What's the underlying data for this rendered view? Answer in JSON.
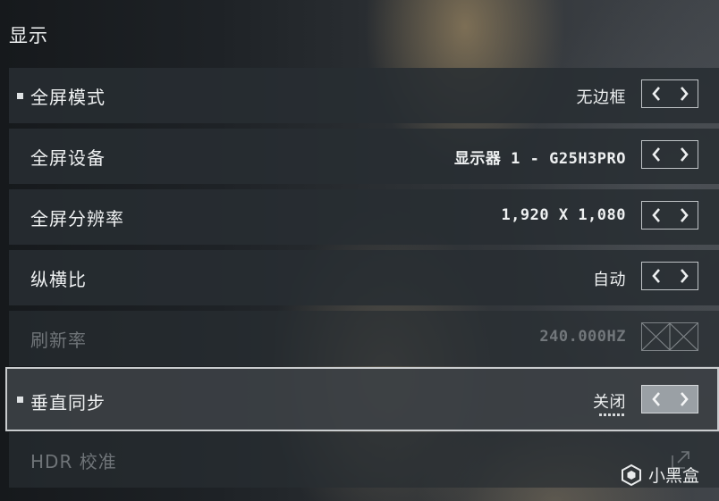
{
  "panel": {
    "title": "显示"
  },
  "rows": [
    {
      "label": "全屏模式",
      "value": "无边框"
    },
    {
      "label": "全屏设备",
      "value": "显示器 1 - G25H3PRO"
    },
    {
      "label": "全屏分辨率",
      "value": "1,920 X 1,080"
    },
    {
      "label": "纵横比",
      "value": "自动"
    },
    {
      "label": "刷新率",
      "value": "240.000HZ"
    },
    {
      "label": "垂直同步",
      "value": "关闭"
    },
    {
      "label": "HDR 校准"
    }
  ],
  "watermark": {
    "text": "小黑盒"
  },
  "icons": {
    "prev": "chevron-left-icon",
    "next": "chevron-right-icon",
    "disabled": "cross-box-icon",
    "external": "external-link-icon",
    "logo": "heybox-logo-icon"
  },
  "colors": {
    "row_bg": "#282d32",
    "row_selected_border": "#c9ccce",
    "text": "#eef0f1",
    "text_disabled": "#6f7478"
  }
}
